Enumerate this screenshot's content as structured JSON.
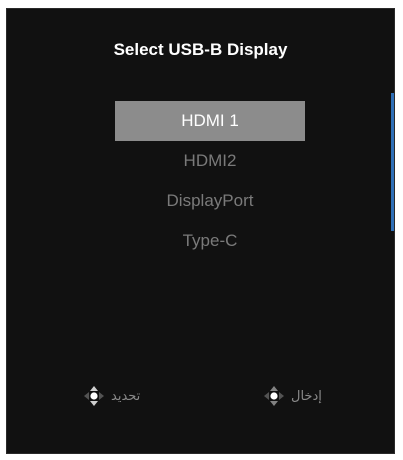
{
  "title": "Select USB-B Display",
  "options": [
    {
      "label": "HDMI 1",
      "selected": true
    },
    {
      "label": "HDMI2",
      "selected": false
    },
    {
      "label": "DisplayPort",
      "selected": false
    },
    {
      "label": "Type-C",
      "selected": false
    }
  ],
  "hints": {
    "select": {
      "label": "تحديد",
      "icon": "joystick-up-down-icon"
    },
    "enter": {
      "label": "إدخال",
      "icon": "joystick-press-icon"
    }
  },
  "colors": {
    "background": "#111111",
    "selected_bg": "#8c8c8c",
    "scrollbar": "#2f6fb7"
  }
}
